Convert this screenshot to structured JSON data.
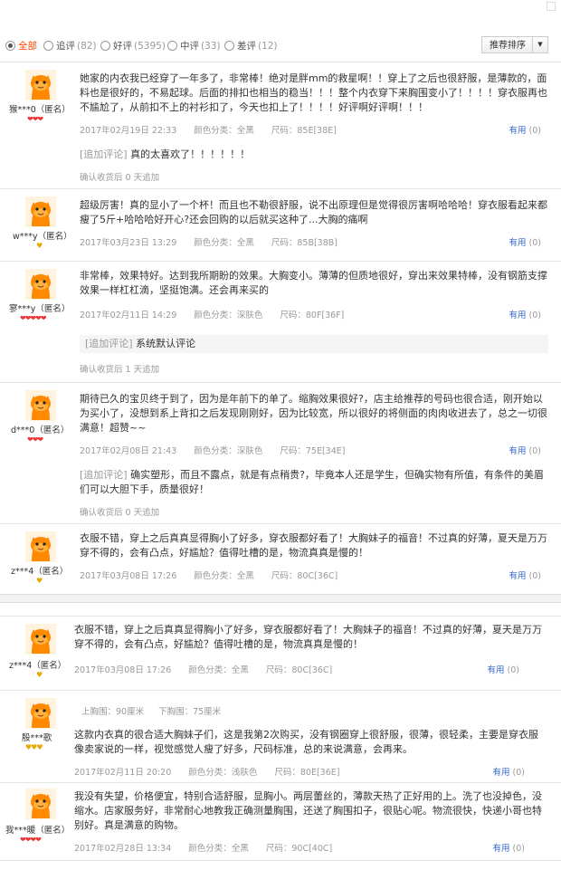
{
  "filters": [
    {
      "label": "全部",
      "count": "",
      "selected": true
    },
    {
      "label": "追评",
      "count": "(82)",
      "selected": false
    },
    {
      "label": "好评",
      "count": "(5395)",
      "selected": false
    },
    {
      "label": "中评",
      "count": "(33)",
      "selected": false
    },
    {
      "label": "差评",
      "count": "(12)",
      "selected": false
    }
  ],
  "sort": {
    "label": "推荐排序"
  },
  "meta_labels": {
    "color": "颜色分类：",
    "size": "尺码：",
    "useful": "有用"
  },
  "after_label": "确认收货后",
  "reviews": [
    {
      "user": "猴***0（匿名）",
      "rank": "❤❤❤",
      "content": "她家的内衣我已经穿了一年多了，非常棒！绝对是胖mm的救星啊！！穿上了之后也很舒服，是薄款的，面料也是很好的，不易起球。后面的排扣也相当的稳当！！！整个内衣穿下来胸围变小了！！！！穿衣服再也不尴尬了，从前扣不上的衬衫扣了，今天也扣上了！！！！好评啊好评啊！！！",
      "date": "2017年02月19日 22:33",
      "color": "全黑",
      "size": "85E[38E]",
      "useful": "(0)",
      "append_tag": "[追加评论]",
      "append_text": "真的太喜欢了！！！！！！",
      "after_text": "0 天追加"
    },
    {
      "user": "w***y（匿名）",
      "rank": "♥",
      "content": "超级厉害！真的显小了一个杯！而且也不勒很舒服，说不出原理但是觉得很厉害啊哈哈哈！穿衣服看起来都瘦了5斤+哈哈哈好开心?还会回购的以后就买这种了...大胸的痛啊",
      "date": "2017年03月23日 13:29",
      "color": "全黑",
      "size": "85B[38B]",
      "useful": "(0)"
    },
    {
      "user": "寥***y（匿名）",
      "rank": "❤❤❤❤❤",
      "content": "非常棒，效果特好。达到我所期盼的效果。大胸变小。薄薄的但质地很好，穿出来效果特棒，没有钢筋支撑效果一样杠杠滴，坚挺饱满。还会再来买的",
      "date": "2017年02月11日 14:29",
      "color": "深肤色",
      "size": "80F[36F]",
      "useful": "(0)",
      "append_tag": "[追加评论]",
      "append_text": "系统默认评论",
      "after_text": "1 天追加"
    },
    {
      "user": "d***0（匿名）",
      "rank": "❤❤❤",
      "content": "期待已久的宝贝终于到了，因为是年前下的单了。缩胸效果很好?，店主给推荐的号码也很合适，刚开始以为买小了，没想到系上背扣之后发现刚刚好，因为比较宽，所以很好的将侧面的肉肉收进去了，总之一切很满意！超赞~~",
      "date": "2017年02月08日 21:43",
      "color": "深肤色",
      "size": "75E[34E]",
      "useful": "(0)",
      "append_tag": "[追加评论]",
      "append_text": "确实塑形，而且不露点，就是有点稍贵?，毕竟本人还是学生，但确实物有所值，有条件的美眉们可以大胆下手，质量很好！",
      "after_text": "0 天追加"
    },
    {
      "user": "z***4（匿名）",
      "rank": "♥",
      "content": "衣服不错，穿上之后真真显得胸小了好多，穿衣服都好看了！大胸妹子的福音！不过真的好薄，夏天是万万穿不得的，会有凸点，好尴尬？值得吐槽的是，物流真真是慢的！",
      "date": "2017年03月08日 17:26",
      "color": "全黑",
      "size": "80C[36C]",
      "useful": "(0)"
    },
    {
      "user": "z***4（匿名）",
      "rank": "♥",
      "content": "衣服不错，穿上之后真真显得胸小了好多，穿衣服都好看了！大胸妹子的福音！不过真的好薄，夏天是万万穿不得的，会有凸点，好尴尬？值得吐槽的是，物流真真是慢的！",
      "date": "2017年03月08日 17:26",
      "color": "全黑",
      "size": "80C[36C]",
      "useful": "(0)"
    },
    {
      "user": "殷***歌",
      "rank": "♥♥♥",
      "shared_a": "上胸围：90厘米",
      "shared_b": "下胸围：75厘米",
      "content": "这款内衣真的很合适大胸妹子们，这是我第2次购买，没有钢圈穿上很舒服，很薄，很轻柔，主要是穿衣服像卖家说的一样，视觉感觉人瘦了好多，尺码标准，总的来说满意，会再来。",
      "date": "2017年02月11日 20:20",
      "color": "浅肤色",
      "size": "80E[36E]",
      "useful": "(0)"
    },
    {
      "user": "我***暖（匿名）",
      "rank": "❤❤❤❤",
      "content": "我没有失望，价格便宜，特别合适舒服，显胸小。两层蕾丝的，薄款天热了正好用的上。洗了也没掉色，没缩水。店家服务好，非常耐心地教我正确测量胸围，还送了胸围扣子，很贴心呢。物流很快，快递小哥也特别好。真是满意的购物。",
      "date": "2017年02月28日 13:34",
      "color": "全黑",
      "size": "90C[40C]",
      "useful": "(0)"
    }
  ]
}
